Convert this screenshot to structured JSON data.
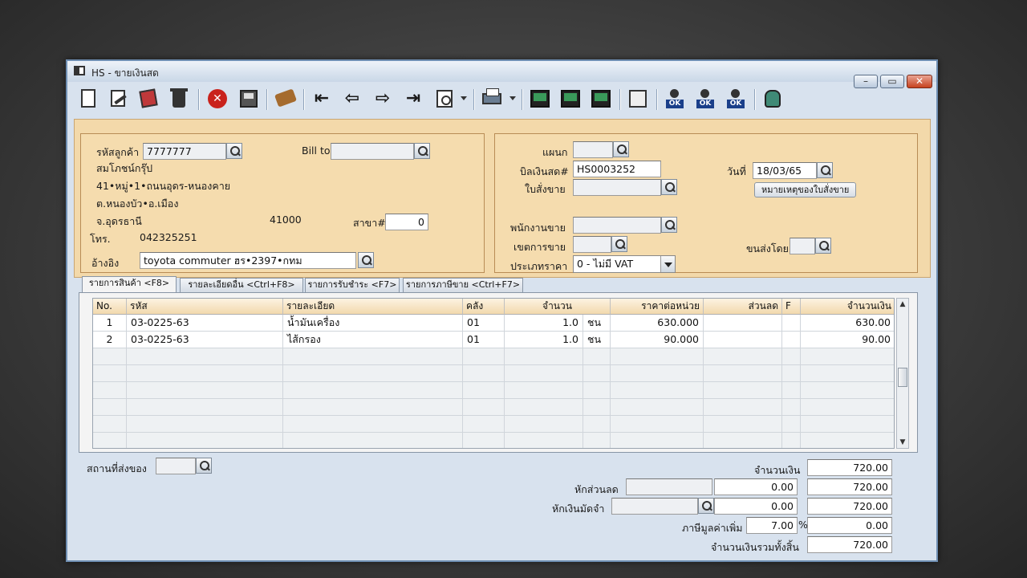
{
  "window": {
    "title": "HS - ขายเงินสด",
    "controls": {
      "minimize": "–",
      "maximize": "▭",
      "close": "✕"
    }
  },
  "toolbar": {
    "icons": [
      "new-doc",
      "edit",
      "attach",
      "delete",
      "cancel",
      "save",
      "tools",
      "first",
      "previous",
      "next",
      "last",
      "search",
      "print",
      "report1",
      "report2",
      "report3",
      "calculator",
      "ok-approve",
      "ok-approve-2",
      "ok-approve-3",
      "database"
    ],
    "first": "⇤",
    "previous": "⇦",
    "next": "⇨",
    "last": "⇥",
    "cancel": "✕",
    "ok": "OK"
  },
  "customer": {
    "code_label": "รหัสลูกค้า",
    "code_value": "7777777",
    "bill_to_label": "Bill to",
    "bill_to_value": "",
    "name": "สมโภชน์กรุ๊ป",
    "address1": "41•หมู่•1•ถนนอุดร-หนองคาย",
    "address2": "ต.หนองบัว•อ.เมือง",
    "address3": "จ.อุดรธานี",
    "postcode": "41000",
    "branch_label": "สาขา#",
    "branch_value": "0",
    "phone_label": "โทร.",
    "phone_value": "042325251",
    "ref_label": "อ้างอิง",
    "ref_value": "toyota commuter ฮร•2397•กทม"
  },
  "document": {
    "department_label": "แผนก",
    "department_value": "",
    "bill_label": "บิลเงินสด#",
    "bill_value": "HS0003252",
    "date_label": "วันที่",
    "date_value": "18/03/65",
    "order_label": "ใบสั่งขาย",
    "order_value": "",
    "order_note_button": "หมายเหตุของใบสั่งขาย",
    "salesman_label": "พนักงานขาย",
    "salesman_value": "",
    "area_label": "เขตการขาย",
    "area_value": "",
    "shipper_label": "ขนส่งโดย",
    "shipper_value": "",
    "price_type_label": "ประเภทราคา",
    "price_type_value": "0 - ไม่มี VAT"
  },
  "tabs": [
    {
      "label": "รายการสินค้า <F8>"
    },
    {
      "label": "รายละเอียดอื่น <Ctrl+F8>"
    },
    {
      "label": "รายการรับชำระ <F7>"
    },
    {
      "label": "รายการภาษีขาย <Ctrl+F7>"
    }
  ],
  "grid": {
    "headers": [
      "No.",
      "รหัส",
      "รายละเอียด",
      "คลัง",
      "จำนวน",
      "ราคาต่อหน่วย",
      "ส่วนลด",
      "F",
      "จำนวนเงิน"
    ],
    "rows": [
      {
        "no": "1",
        "code": "03-0225-63",
        "desc": "น้ำมันเครื่อง",
        "wh": "01",
        "qty": "1.0",
        "unit": "ชน",
        "price": "630.000",
        "disc": "",
        "f": "",
        "amount": "630.00"
      },
      {
        "no": "2",
        "code": "03-0225-63",
        "desc": "ไส้กรอง",
        "wh": "01",
        "qty": "1.0",
        "unit": "ชน",
        "price": "90.000",
        "disc": "",
        "f": "",
        "amount": "90.00"
      }
    ],
    "scroll_up": "▲",
    "scroll_down": "▼"
  },
  "footer": {
    "ship_place_label": "สถานที่ส่งของ",
    "ship_place_value": "",
    "amount_label": "จำนวนเงิน",
    "amount_value": "720.00",
    "discount_label": "หักส่วนลด",
    "discount_value": "0.00",
    "after_discount_value": "720.00",
    "deposit_label": "หักเงินมัดจำ",
    "deposit_value": "0.00",
    "after_deposit_value": "720.00",
    "vat_label": "ภาษีมูลค่าเพิ่ม",
    "vat_rate": "7.00",
    "vat_percent": "%",
    "vat_value": "0.00",
    "total_label": "จำนวนเงินรวมทั้งสิ้น",
    "total_value": "720.00"
  }
}
